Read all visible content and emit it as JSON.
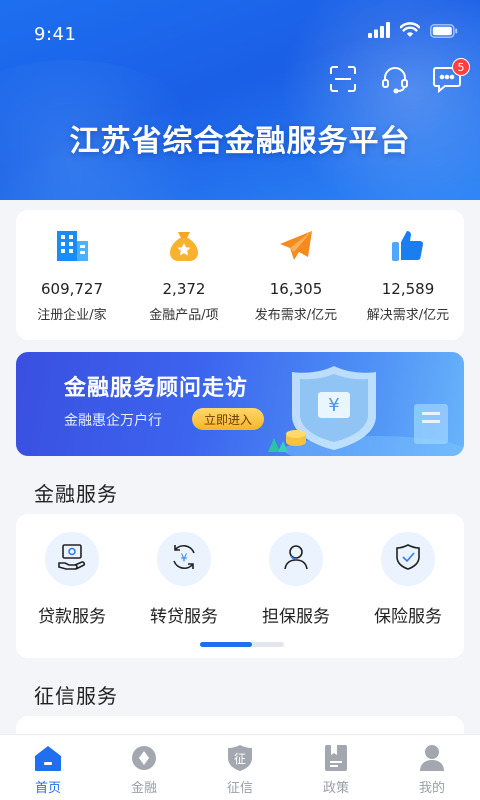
{
  "status_bar": {
    "time": "9:41"
  },
  "header": {
    "title": "江苏省综合金融服务平台",
    "notification_count": "5",
    "icons": [
      "scan-icon",
      "headset-icon",
      "message-icon"
    ]
  },
  "stats": [
    {
      "value": "609,727",
      "label": "注册企业/家",
      "icon": "building-icon",
      "color": "#1a8cf5"
    },
    {
      "value": "2,372",
      "label": "金融产品/项",
      "icon": "money-bag-icon",
      "color": "#f6a623"
    },
    {
      "value": "16,305",
      "label": "发布需求/亿元",
      "icon": "paper-plane-icon",
      "color": "#f58a1f"
    },
    {
      "value": "12,589",
      "label": "解决需求/亿元",
      "icon": "thumbs-up-icon",
      "color": "#1a7ef0"
    }
  ],
  "banner": {
    "title": "金融服务顾问走访",
    "subtitle": "金融惠企万户行",
    "button": "立即进入"
  },
  "financial_services": {
    "title": "金融服务",
    "items": [
      {
        "label": "贷款服务",
        "icon": "loan-icon"
      },
      {
        "label": "转贷服务",
        "icon": "refinance-icon"
      },
      {
        "label": "担保服务",
        "icon": "guarantee-icon"
      },
      {
        "label": "保险服务",
        "icon": "insurance-icon"
      }
    ],
    "page_progress": 0.62
  },
  "credit_services": {
    "title": "征信服务"
  },
  "tabbar": [
    {
      "label": "首页",
      "icon": "home-icon",
      "active": true
    },
    {
      "label": "金融",
      "icon": "finance-icon",
      "active": false
    },
    {
      "label": "征信",
      "icon": "credit-icon",
      "active": false
    },
    {
      "label": "政策",
      "icon": "policy-icon",
      "active": false
    },
    {
      "label": "我的",
      "icon": "profile-icon",
      "active": false
    }
  ],
  "colors": {
    "primary": "#1f6fee",
    "inactive": "#9aa0a8",
    "badge": "#ff4040"
  }
}
